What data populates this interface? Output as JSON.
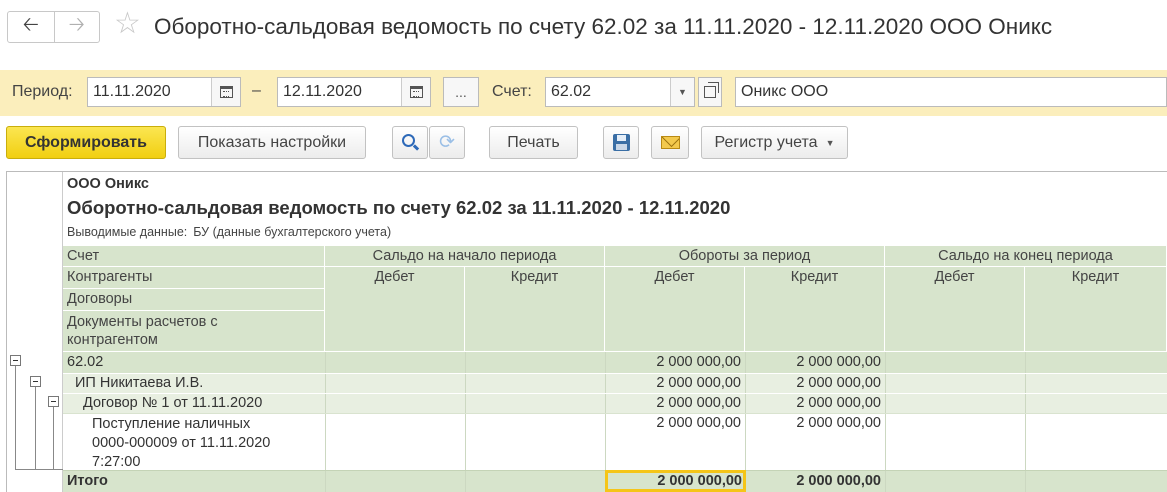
{
  "window": {
    "title": "Оборотно-сальдовая ведомость по счету 62.02 за 11.11.2020 - 12.11.2020 ООО Оникс",
    "back_icon": "arrow-left-icon",
    "forward_icon": "arrow-right-icon",
    "favorite_icon": "star-icon"
  },
  "params": {
    "period_label": "Период:",
    "date_from": "11.11.2020",
    "date_dash": "–",
    "date_to": "12.11.2020",
    "ellipsis": "...",
    "account_label": "Счет:",
    "account_value": "62.02",
    "organization_value": "Оникс ООО"
  },
  "toolbar": {
    "generate_label": "Сформировать",
    "settings_label": "Показать настройки",
    "print_label": "Печать",
    "register_label": "Регистр учета"
  },
  "report": {
    "organization": "ООО Оникс",
    "title": "Оборотно-сальдовая ведомость по счету 62.02 за 11.11.2020 - 12.11.2020",
    "shown_label": "Выводимые данные:",
    "shown_value": "БУ (данные бухгалтерского учета)",
    "header": {
      "col_account": "Счет",
      "col_contractors": "Контрагенты",
      "col_contracts": "Договоры",
      "col_documents": "Документы расчетов с контрагентом",
      "opening": "Сальдо на начало периода",
      "turnover": "Обороты за период",
      "closing": "Сальдо на конец периода",
      "debit": "Дебет",
      "credit": "Кредит"
    },
    "rows": [
      {
        "label": "62.02",
        "open_debit": "",
        "open_credit": "",
        "turn_debit": "2 000 000,00",
        "turn_credit": "2 000 000,00",
        "close_debit": "",
        "close_credit": ""
      },
      {
        "label": "ИП Никитаева И.В.",
        "open_debit": "",
        "open_credit": "",
        "turn_debit": "2 000 000,00",
        "turn_credit": "2 000 000,00",
        "close_debit": "",
        "close_credit": ""
      },
      {
        "label": "Договор № 1 от 11.11.2020",
        "open_debit": "",
        "open_credit": "",
        "turn_debit": "2 000 000,00",
        "turn_credit": "2 000 000,00",
        "close_debit": "",
        "close_credit": ""
      },
      {
        "label_line1": "Поступление наличных",
        "label_line2": "0000-000009 от 11.11.2020",
        "label_line3": "7:27:00",
        "open_debit": "",
        "open_credit": "",
        "turn_debit": "2 000 000,00",
        "turn_credit": "2 000 000,00",
        "close_debit": "",
        "close_credit": ""
      }
    ],
    "total": {
      "label": "Итого",
      "turn_debit": "2 000 000,00",
      "turn_credit": "2 000 000,00"
    }
  },
  "colors": {
    "param_band": "#fbeebc",
    "header_green": "#d7e4cc",
    "row_group": "#d7e4cc",
    "row_sub": "#e8efe1",
    "total_row": "#d7e4cc",
    "primary_button": "#f1cf11",
    "selected_outline": "#f5c518"
  }
}
